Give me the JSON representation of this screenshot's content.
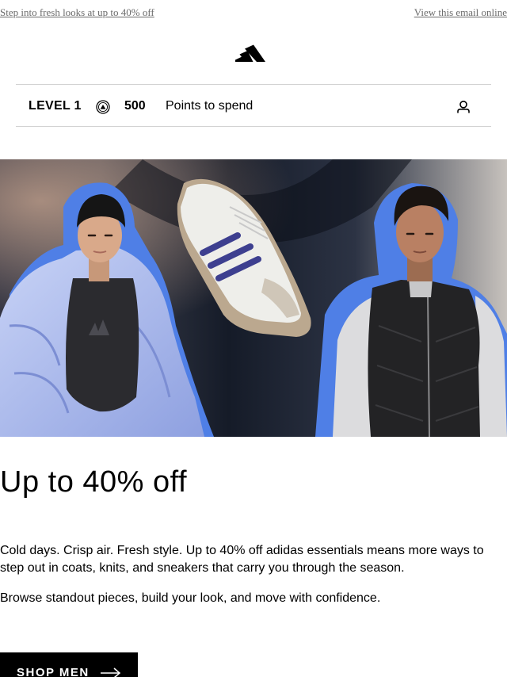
{
  "preheader": {
    "promo_link": "Step into fresh looks at up to 40% off",
    "view_online_link": "View this email online"
  },
  "header": {
    "logo_icon": "adidas-performance-logo"
  },
  "loyalty": {
    "level": "LEVEL 1",
    "coin_icon": "adiclub-points-coin-icon",
    "points": "500",
    "points_label": "Points to spend",
    "account_icon": "user-account-icon"
  },
  "hero": {
    "description": "campaign image: woman in periwinkle puffer jacket, white and navy sneaker, man in black quilted vest on blue torn-paper background",
    "accent_color": "#4f7fe6"
  },
  "content": {
    "headline": "Up to 40% off",
    "paragraph1": "Cold days. Crisp air. Fresh style. Up to 40% off adidas essentials means more ways to step out in coats, knits, and sneakers that carry you through the season.",
    "paragraph2": "Browse standout pieces, build your look, and move with confidence."
  },
  "cta": {
    "label": "SHOP MEN",
    "icon": "arrow-right-icon",
    "background": "#000000",
    "text_color": "#ffffff"
  }
}
